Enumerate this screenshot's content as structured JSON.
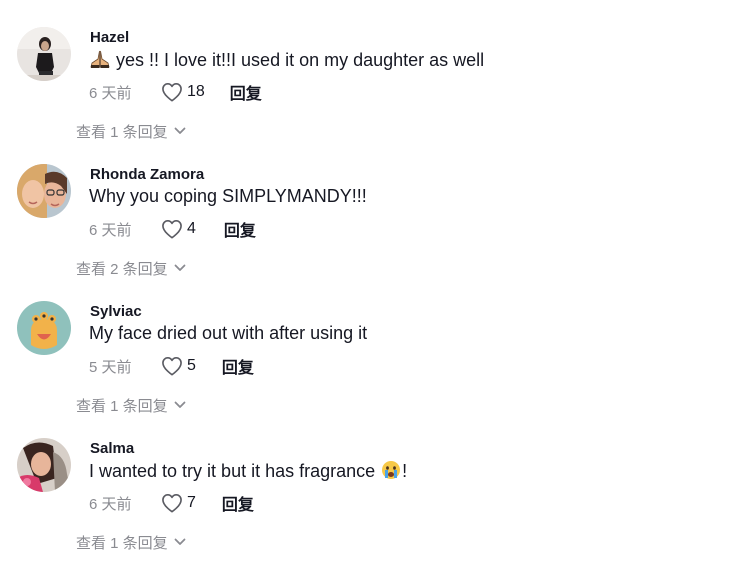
{
  "comments": [
    {
      "username": "Hazel",
      "emoji": "praying-hands-emoji",
      "text": " yes !! I love it!!I used it on my daughter as well",
      "date": "6 天前",
      "likes": "18",
      "reply_label": "回复",
      "view_replies": "查看 1 条回复"
    },
    {
      "username": "Rhonda Zamora",
      "text": "Why you coping SIMPLYMANDY!!!",
      "date": "6 天前",
      "likes": "4",
      "reply_label": "回复",
      "view_replies": "查看 2 条回复"
    },
    {
      "username": "Sylviac",
      "text": "My face dried out with after using it",
      "date": "5 天前",
      "likes": "5",
      "reply_label": "回复",
      "view_replies": "查看 1 条回复"
    },
    {
      "username": "Salma",
      "text": "I wanted to try it but it has fragrance ",
      "emoji_after": "crying-face-emoji",
      "text_end": "!",
      "date": "6 天前",
      "likes": "7",
      "reply_label": "回复",
      "view_replies": "查看 1 条回复"
    }
  ],
  "icons": {
    "like": "heart-outline-icon",
    "expand": "chevron-down-icon"
  },
  "colors": {
    "primary_text": "#161823",
    "secondary_text": "#8a8b91"
  }
}
